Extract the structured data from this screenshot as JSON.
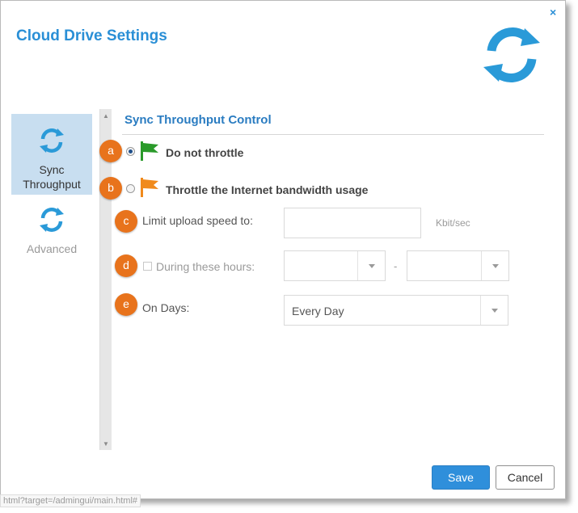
{
  "dialog": {
    "title": "Cloud Drive Settings",
    "close_glyph": "×",
    "header_icon": "sync-icon"
  },
  "sidebar": {
    "items": [
      {
        "label_line1": "Sync",
        "label_line2": "Throughput",
        "icon": "sync-icon",
        "active": true
      },
      {
        "label_line1": "Advanced",
        "icon": "sync-icon",
        "active": false
      }
    ]
  },
  "section": {
    "title": "Sync Throughput Control"
  },
  "callouts": [
    "a",
    "b",
    "c",
    "d",
    "e"
  ],
  "options": {
    "no_throttle": {
      "label": "Do not throttle",
      "selected": true,
      "flag_color": "#2a9a2a"
    },
    "throttle": {
      "label": "Throttle the Internet bandwidth usage",
      "selected": false,
      "flag_color": "#f08a1c"
    }
  },
  "fields": {
    "limit_upload": {
      "label": "Limit upload speed to:",
      "value": "",
      "unit": "Kbit/sec"
    },
    "during_hours": {
      "label": "During these hours:",
      "checked": false,
      "from": "",
      "to": "",
      "separator": "-"
    },
    "on_days": {
      "label": "On Days:",
      "value": "Every Day"
    }
  },
  "buttons": {
    "save": "Save",
    "cancel": "Cancel"
  },
  "status_bar": {
    "url": "html?target=/admingui/main.html#"
  },
  "colors": {
    "accent": "#2a8fd6",
    "callout": "#e8731c",
    "sidebar_active": "#c8def0"
  }
}
